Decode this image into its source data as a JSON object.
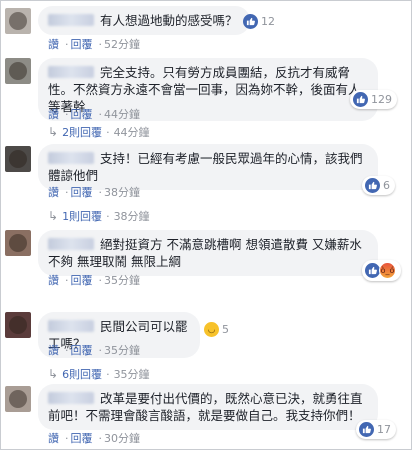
{
  "comments": [
    {
      "text": "有人想過地動的感受嗎？",
      "like_label": "讚",
      "reply_label": "回覆",
      "time": "52分鐘",
      "reactions": [
        {
          "icon": "like",
          "count": "12"
        }
      ]
    },
    {
      "text": "完全支持。只有勞方成員團結，反抗才有威脅性。不然資方永遠不會當一回事，因為妳不幹，後面有人等著幹",
      "like_label": "讚",
      "reply_label": "回覆",
      "time": "44分鐘",
      "reactions": [
        {
          "icon": "like",
          "count": "129"
        }
      ],
      "replies_text": "2則回覆"
    },
    {
      "text": "支持！已經有考慮一般民眾過年的心情，該我們體諒他們",
      "like_label": "讚",
      "reply_label": "回覆",
      "time": "38分鐘",
      "reactions": [
        {
          "icon": "like",
          "count": "6"
        }
      ],
      "replies_text": "1則回覆"
    },
    {
      "text": "絕對挺資方 不滿意跳槽啊 想領遣散費 又嫌薪水不夠 無理取鬧 無限上綱",
      "like_label": "讚",
      "reply_label": "回覆",
      "time": "35分鐘",
      "reactions": [
        {
          "icon": "like",
          "count": ""
        },
        {
          "icon": "angry",
          "count": ""
        }
      ]
    },
    {
      "text": "民間公司可以罷工嗎？",
      "like_label": "讚",
      "reply_label": "回覆",
      "time": "35分鐘",
      "reactions": [
        {
          "icon": "haha",
          "count": "5"
        }
      ],
      "replies_text": "6則回覆"
    },
    {
      "text": "改革是要付出代價的，既然心意已決，就勇往直前吧！不需理會酸言酸語，就是要做自己。我支持你們！",
      "like_label": "讚",
      "reply_label": "回覆",
      "time": "30分鐘",
      "reactions": [
        {
          "icon": "like",
          "count": "17"
        }
      ]
    }
  ],
  "colors": {
    "link": "#4267b2",
    "meta": "#90949c",
    "bubble": "#f2f3f5",
    "like": "#4267b2"
  }
}
